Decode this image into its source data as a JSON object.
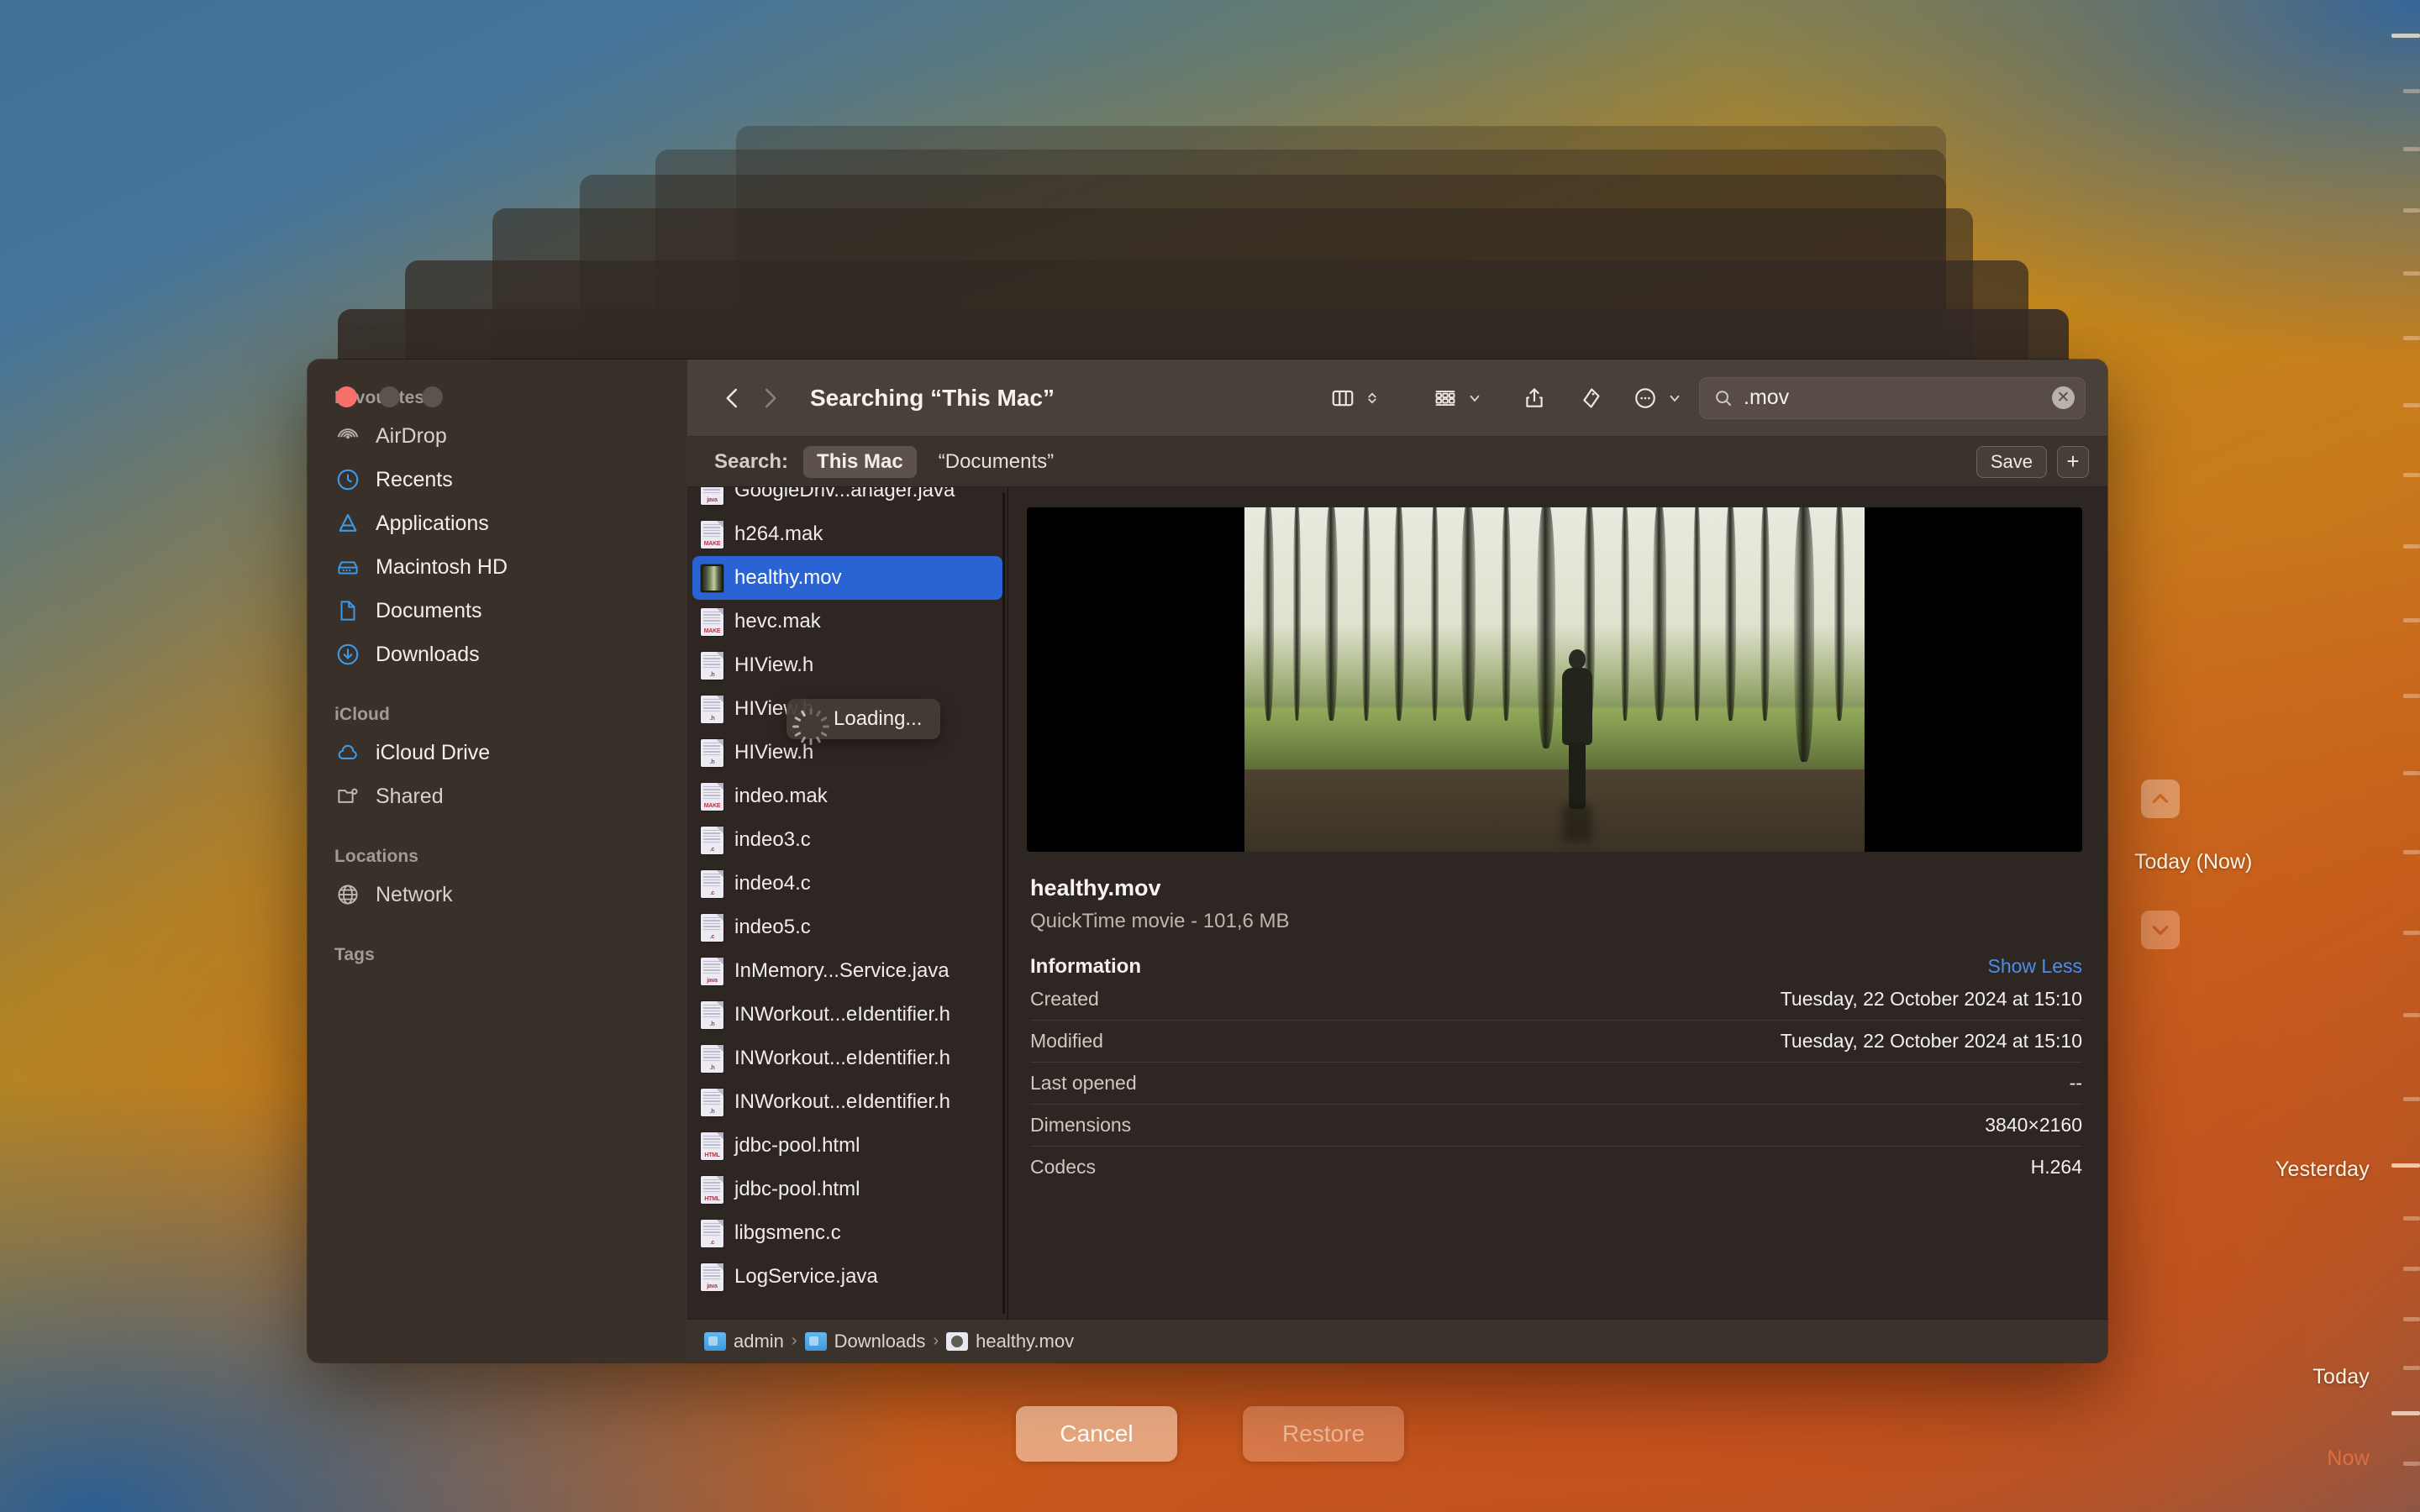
{
  "backdrop": {
    "gradient_top_left": "#3f7195",
    "gradient_mid": "#c08a1c",
    "gradient_bottom_right": "#c4561d",
    "gradient_bottom_left": "#2b5e92"
  },
  "timemachine": {
    "current_label": "Today (Now)",
    "up_arrow_icon": "chevron-up-icon",
    "down_arrow_icon": "chevron-down-icon",
    "timeline_labels": [
      {
        "text": "Yesterday",
        "dim": false
      },
      {
        "text": "Today",
        "dim": false
      },
      {
        "text": "Now",
        "dim": true
      }
    ],
    "cancel_label": "Cancel",
    "restore_label": "Restore"
  },
  "window": {
    "traffic_lights": [
      "close-button",
      "minimize-button",
      "zoom-button"
    ]
  },
  "sidebar": {
    "sections": [
      {
        "title": "Favourites",
        "items": [
          {
            "label": "AirDrop",
            "icon": "airdrop-icon",
            "muted": true
          },
          {
            "label": "Recents",
            "icon": "clock-icon",
            "muted": false
          },
          {
            "label": "Applications",
            "icon": "applications-icon",
            "muted": false
          },
          {
            "label": "Macintosh HD",
            "icon": "harddisk-icon",
            "muted": false
          },
          {
            "label": "Documents",
            "icon": "documents-icon",
            "muted": false
          },
          {
            "label": "Downloads",
            "icon": "downloads-icon",
            "muted": false
          }
        ]
      },
      {
        "title": "iCloud",
        "items": [
          {
            "label": "iCloud Drive",
            "icon": "cloud-icon",
            "muted": false
          },
          {
            "label": "Shared",
            "icon": "shared-folder-icon",
            "muted": true
          }
        ]
      },
      {
        "title": "Locations",
        "items": [
          {
            "label": "Network",
            "icon": "globe-icon",
            "muted": true
          }
        ]
      },
      {
        "title": "Tags",
        "items": []
      }
    ]
  },
  "toolbar": {
    "back_icon": "chevron-left-icon",
    "forward_icon": "chevron-right-icon",
    "title": "Searching “This Mac”",
    "column_view_icon": "column-view-icon",
    "sort_icon": "sort-updown-icon",
    "group_icon": "group-view-icon",
    "share_icon": "share-icon",
    "tag_icon": "tag-icon",
    "more_icon": "more-ellipsis-icon",
    "search": {
      "icon": "search-icon",
      "value": ".mov",
      "placeholder": "Search",
      "clear_icon": "clear-circle-icon"
    }
  },
  "scopebar": {
    "label": "Search:",
    "chips": [
      {
        "text": "This Mac",
        "active": true
      },
      {
        "text": "“Documents”",
        "active": false
      }
    ],
    "save_label": "Save",
    "add_label": "+"
  },
  "filelist": {
    "loading_text": "Loading...",
    "items": [
      {
        "name": "GoogleDriv...anager.java",
        "ext": "java",
        "kind": "document",
        "selected": false
      },
      {
        "name": "h264.mak",
        "ext": "MAKE",
        "kind": "document",
        "selected": false
      },
      {
        "name": "healthy.mov",
        "ext": "mov",
        "kind": "movie",
        "selected": true
      },
      {
        "name": "hevc.mak",
        "ext": "MAKE",
        "kind": "document",
        "selected": false
      },
      {
        "name": "HIView.h",
        "ext": ".h",
        "kind": "document",
        "selected": false
      },
      {
        "name": "HIView.h",
        "ext": ".h",
        "kind": "document",
        "selected": false
      },
      {
        "name": "HIView.h",
        "ext": ".h",
        "kind": "document",
        "selected": false
      },
      {
        "name": "indeo.mak",
        "ext": "MAKE",
        "kind": "document",
        "selected": false
      },
      {
        "name": "indeo3.c",
        "ext": ".c",
        "kind": "document",
        "selected": false
      },
      {
        "name": "indeo4.c",
        "ext": ".c",
        "kind": "document",
        "selected": false
      },
      {
        "name": "indeo5.c",
        "ext": ".c",
        "kind": "document",
        "selected": false
      },
      {
        "name": "InMemory...Service.java",
        "ext": "java",
        "kind": "document",
        "selected": false
      },
      {
        "name": "INWorkout...eIdentifier.h",
        "ext": ".h",
        "kind": "document",
        "selected": false
      },
      {
        "name": "INWorkout...eIdentifier.h",
        "ext": ".h",
        "kind": "document",
        "selected": false
      },
      {
        "name": "INWorkout...eIdentifier.h",
        "ext": ".h",
        "kind": "document",
        "selected": false
      },
      {
        "name": "jdbc-pool.html",
        "ext": "HTML",
        "kind": "document",
        "selected": false
      },
      {
        "name": "jdbc-pool.html",
        "ext": "HTML",
        "kind": "document",
        "selected": false
      },
      {
        "name": "libgsmenc.c",
        "ext": ".c",
        "kind": "document",
        "selected": false
      },
      {
        "name": "LogService.java",
        "ext": "java",
        "kind": "document",
        "selected": false
      }
    ]
  },
  "preview": {
    "media_alt": "video-thumbnail-forest-path-walker",
    "file_name": "healthy.mov",
    "kind_and_size": "QuickTime movie - 101,6 MB",
    "info_title": "Information",
    "show_less_label": "Show Less",
    "rows": [
      {
        "key": "Created",
        "value": "Tuesday, 22 October 2024 at 15:10"
      },
      {
        "key": "Modified",
        "value": "Tuesday, 22 October 2024 at 15:10"
      },
      {
        "key": "Last opened",
        "value": "--"
      },
      {
        "key": "Dimensions",
        "value": "3840×2160"
      },
      {
        "key": "Codecs",
        "value": "H.264"
      }
    ]
  },
  "pathbar": {
    "items": [
      {
        "label": "admin",
        "icon": "folder-home-icon"
      },
      {
        "label": "Downloads",
        "icon": "folder-downloads-icon"
      },
      {
        "label": "healthy.mov",
        "icon": "quicktime-file-icon"
      }
    ],
    "separator": "›"
  }
}
